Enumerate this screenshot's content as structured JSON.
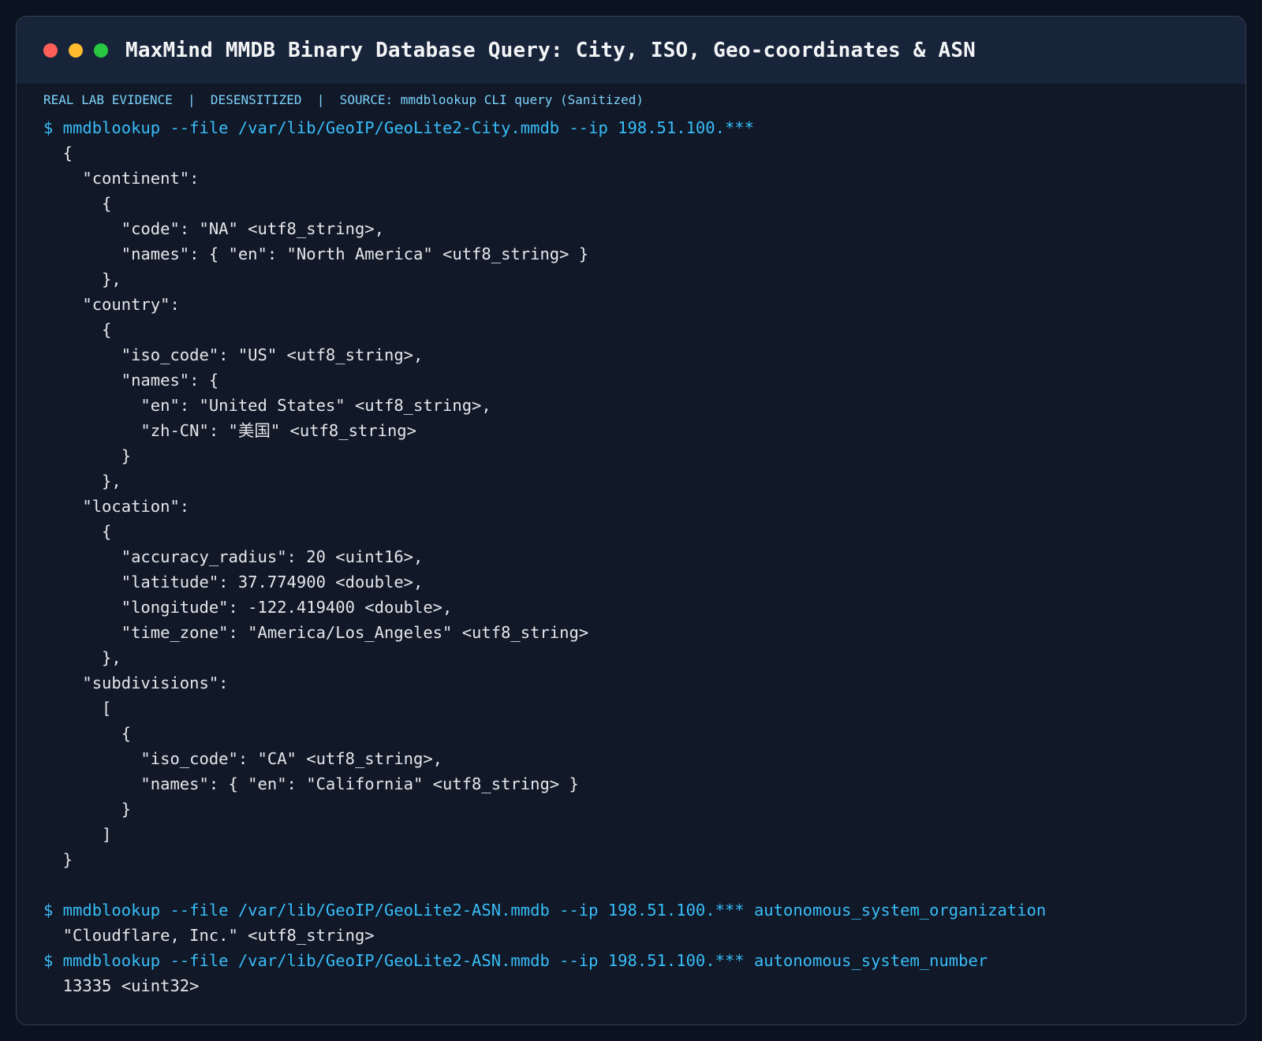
{
  "window": {
    "title": "MaxMind MMDB Binary Database Query: City, ISO, Geo-coordinates & ASN",
    "controls": [
      {
        "name": "close",
        "color": "#ff5f57"
      },
      {
        "name": "minimize",
        "color": "#febc2e"
      },
      {
        "name": "maximize",
        "color": "#28c840"
      }
    ]
  },
  "meta": "REAL LAB EVIDENCE  |  DESENSITIZED  |  SOURCE: mmdblookup CLI query (Sanitized)",
  "colors": {
    "command": "#38bdf8",
    "output": "#e5e7eb",
    "meta": "#7dd3fc",
    "background": "#111827",
    "titlebar": "#18243a"
  },
  "terminal": {
    "lines": [
      {
        "type": "cmd",
        "text": "$ mmdblookup --file /var/lib/GeoIP/GeoLite2-City.mmdb --ip 198.51.100.***"
      },
      {
        "type": "out",
        "text": "  {"
      },
      {
        "type": "out",
        "text": "    \"continent\":"
      },
      {
        "type": "out",
        "text": "      {"
      },
      {
        "type": "out",
        "text": "        \"code\": \"NA\" <utf8_string>,"
      },
      {
        "type": "out",
        "text": "        \"names\": { \"en\": \"North America\" <utf8_string> }"
      },
      {
        "type": "out",
        "text": "      },"
      },
      {
        "type": "out",
        "text": "    \"country\":"
      },
      {
        "type": "out",
        "text": "      {"
      },
      {
        "type": "out",
        "text": "        \"iso_code\": \"US\" <utf8_string>,"
      },
      {
        "type": "out",
        "text": "        \"names\": {"
      },
      {
        "type": "out",
        "text": "          \"en\": \"United States\" <utf8_string>,"
      },
      {
        "type": "out",
        "text": "          \"zh-CN\": \"美国\" <utf8_string>"
      },
      {
        "type": "out",
        "text": "        }"
      },
      {
        "type": "out",
        "text": "      },"
      },
      {
        "type": "out",
        "text": "    \"location\":"
      },
      {
        "type": "out",
        "text": "      {"
      },
      {
        "type": "out",
        "text": "        \"accuracy_radius\": 20 <uint16>,"
      },
      {
        "type": "out",
        "text": "        \"latitude\": 37.774900 <double>,"
      },
      {
        "type": "out",
        "text": "        \"longitude\": -122.419400 <double>,"
      },
      {
        "type": "out",
        "text": "        \"time_zone\": \"America/Los_Angeles\" <utf8_string>"
      },
      {
        "type": "out",
        "text": "      },"
      },
      {
        "type": "out",
        "text": "    \"subdivisions\":"
      },
      {
        "type": "out",
        "text": "      ["
      },
      {
        "type": "out",
        "text": "        {"
      },
      {
        "type": "out",
        "text": "          \"iso_code\": \"CA\" <utf8_string>,"
      },
      {
        "type": "out",
        "text": "          \"names\": { \"en\": \"California\" <utf8_string> }"
      },
      {
        "type": "out",
        "text": "        }"
      },
      {
        "type": "out",
        "text": "      ]"
      },
      {
        "type": "out",
        "text": "  }"
      },
      {
        "type": "blank",
        "text": ""
      },
      {
        "type": "cmd",
        "text": "$ mmdblookup --file /var/lib/GeoIP/GeoLite2-ASN.mmdb --ip 198.51.100.*** autonomous_system_organization"
      },
      {
        "type": "out",
        "text": "  \"Cloudflare, Inc.\" <utf8_string>"
      },
      {
        "type": "cmd",
        "text": "$ mmdblookup --file /var/lib/GeoIP/GeoLite2-ASN.mmdb --ip 198.51.100.*** autonomous_system_number"
      },
      {
        "type": "out",
        "text": "  13335 <uint32>"
      }
    ]
  }
}
